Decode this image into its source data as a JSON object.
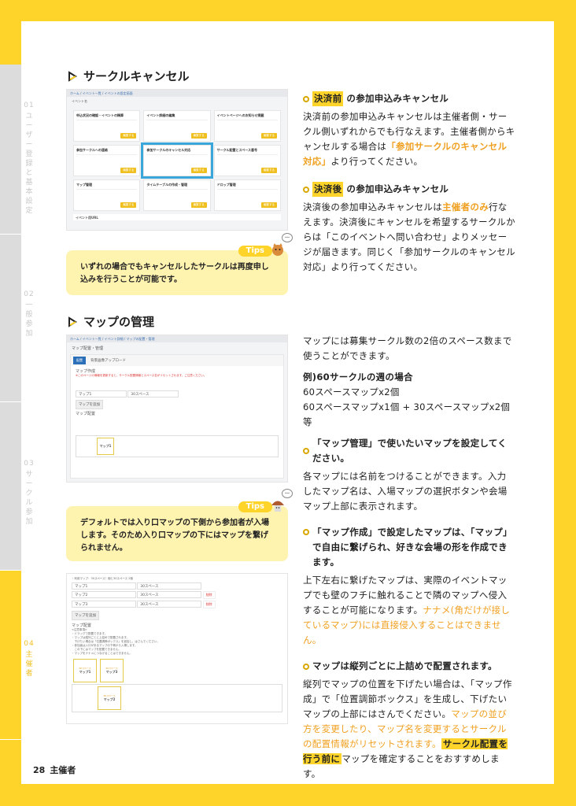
{
  "sidebar": [
    {
      "num": "01",
      "label": "ユーザー登録と基本設定"
    },
    {
      "num": "02",
      "label": "一般参加"
    },
    {
      "num": "03",
      "label": "サークル参加"
    },
    {
      "num": "04",
      "label": "主催者"
    }
  ],
  "section1": {
    "title": "サークルキャンセル",
    "screenshot": {
      "breadcrumb": "ホーム / イベント一覧 / イベントの設定画面",
      "page_label": "イベント名",
      "edit_label": "編集する",
      "cards": [
        "申込状況の確認・イベントの精算",
        "イベント詳細の編集",
        "イベントページへのお知らせ掲載",
        "参加サークルへの連絡",
        "参加サークルのキャンセル対応",
        "サークル配置とスペース番号",
        "マップ管理",
        "タイムテーブルの作成・管理",
        "ドロップ管理"
      ],
      "footer_card": "イベント用URL"
    },
    "tips": {
      "label": "Tips",
      "text": "いずれの場合でもキャンセルしたサークルは再度申し込みを行うことが可能です。"
    },
    "before": {
      "tag": "決済前",
      "heading": "の参加申込みキャンセル",
      "text1": "決済前の参加申込みキャンセルは主催者側・サークル側いずれからでも行なえます。主催者側からキャンセルする場合は",
      "link": "「参加サークルのキャンセル対応」",
      "text2": "より行ってください。"
    },
    "after": {
      "tag": "決済後",
      "heading": "の参加申込みキャンセル",
      "text1": "決済後の参加申込みキャンセルは",
      "em": "主催者のみ",
      "text2": "行なえます。決済後にキャンセルを希望するサークルからは「このイベントへ問い合わせ」よりメッセージが届きます。同じく「参加サークルのキャンセル対応」より行ってください。"
    }
  },
  "section2": {
    "title": "マップの管理",
    "screenshot1": {
      "breadcrumb": "ホーム / イベント一覧 / イベント詳細 / マップの配置・管理",
      "page_title": "マップ配置・管理",
      "tab_active": "配置",
      "tab_other": "背景画像アップロード",
      "create": "マップ作成",
      "warning": "※このページの情報を更新すると、サークル配置情報とスペース名がリセットされます。ご注意ください。",
      "map_name": "マップ1",
      "space": "30スペース",
      "add": "マップを追加",
      "layout": "マップ配置",
      "box_label": "マップ1"
    },
    "tips": {
      "label": "Tips",
      "text": "デフォルトでは入り口マップの下側から参加者が入場します。そのため入り口マップの下にはマップを繋げられません。"
    },
    "screenshot2": {
      "usage": "・利用マップ：30スペース！個と30スペース 2個",
      "maps": [
        "マップ1",
        "マップ2",
        "マップ3"
      ],
      "space": "30スペース",
      "delete": "削除",
      "add": "マップを追加",
      "layout": "マップ配置",
      "notes": [
        "<注意事項>",
        "・ドラッグで配置できます。",
        "・マップは縦列ごとに上詰めで配置されます。",
        "　下げたい場合は「位置調節ボックス」を追加し、はさんでください。",
        "・参加者は入口があるマップの下側から入場します。",
        "　この下にはマップを配置できません。",
        "・マップをナナメにつなげることはできません。"
      ],
      "boxes": [
        "マップ1",
        "マップ3",
        "マップ2"
      ]
    },
    "intro": "マップには募集サークル数の2倍のスペース数まで使うことができます。",
    "example_title": "例)60サークルの週の場合",
    "example_lines": [
      "60スペースマップx2個",
      "60スペースマップx1個 + 30スペースマップx2個等"
    ],
    "point1": {
      "heading": "「マップ管理」で使いたいマップを設定してください。",
      "text": "各マップには名前をつけることができます。入力したマップ名は、入場マップの選択ボタンや会場マップ上部に表示されます。"
    },
    "point2": {
      "heading": "「マップ作成」で設定したマップは、「マップ」で自由に繋げられ、好きな会場の形を作成できます。",
      "text": "上下左右に繋げたマップは、実際のイベントマップでも壁のフチに触れることで隣のマップへ侵入することが可能になります。",
      "em": "ナナメ(角だけが接しているマップ)には直接侵入することはできません。"
    },
    "point3": {
      "heading": "マップは縦列ごとに上詰めで配置されます。",
      "text": "縦列でマップの位置を下げたい場合は、「マップ作成」で「位置調節ボックス」を生成し、下げたいマップの上部にはさんでください。",
      "em": "マップの並び方を変更したり、マップ名を変更するとサークルの配置情報がリセットされます。",
      "hl": "サークル配置を行う前に",
      "tail": "マップを確定することをおすすめします。"
    }
  },
  "footer": {
    "page": "28",
    "section": "主催者"
  },
  "colors": {
    "accent": "#FFD42A",
    "tips_bg": "#FFF3B0",
    "orange": "#F0A020",
    "highlight_border": "#3BA6D9"
  }
}
